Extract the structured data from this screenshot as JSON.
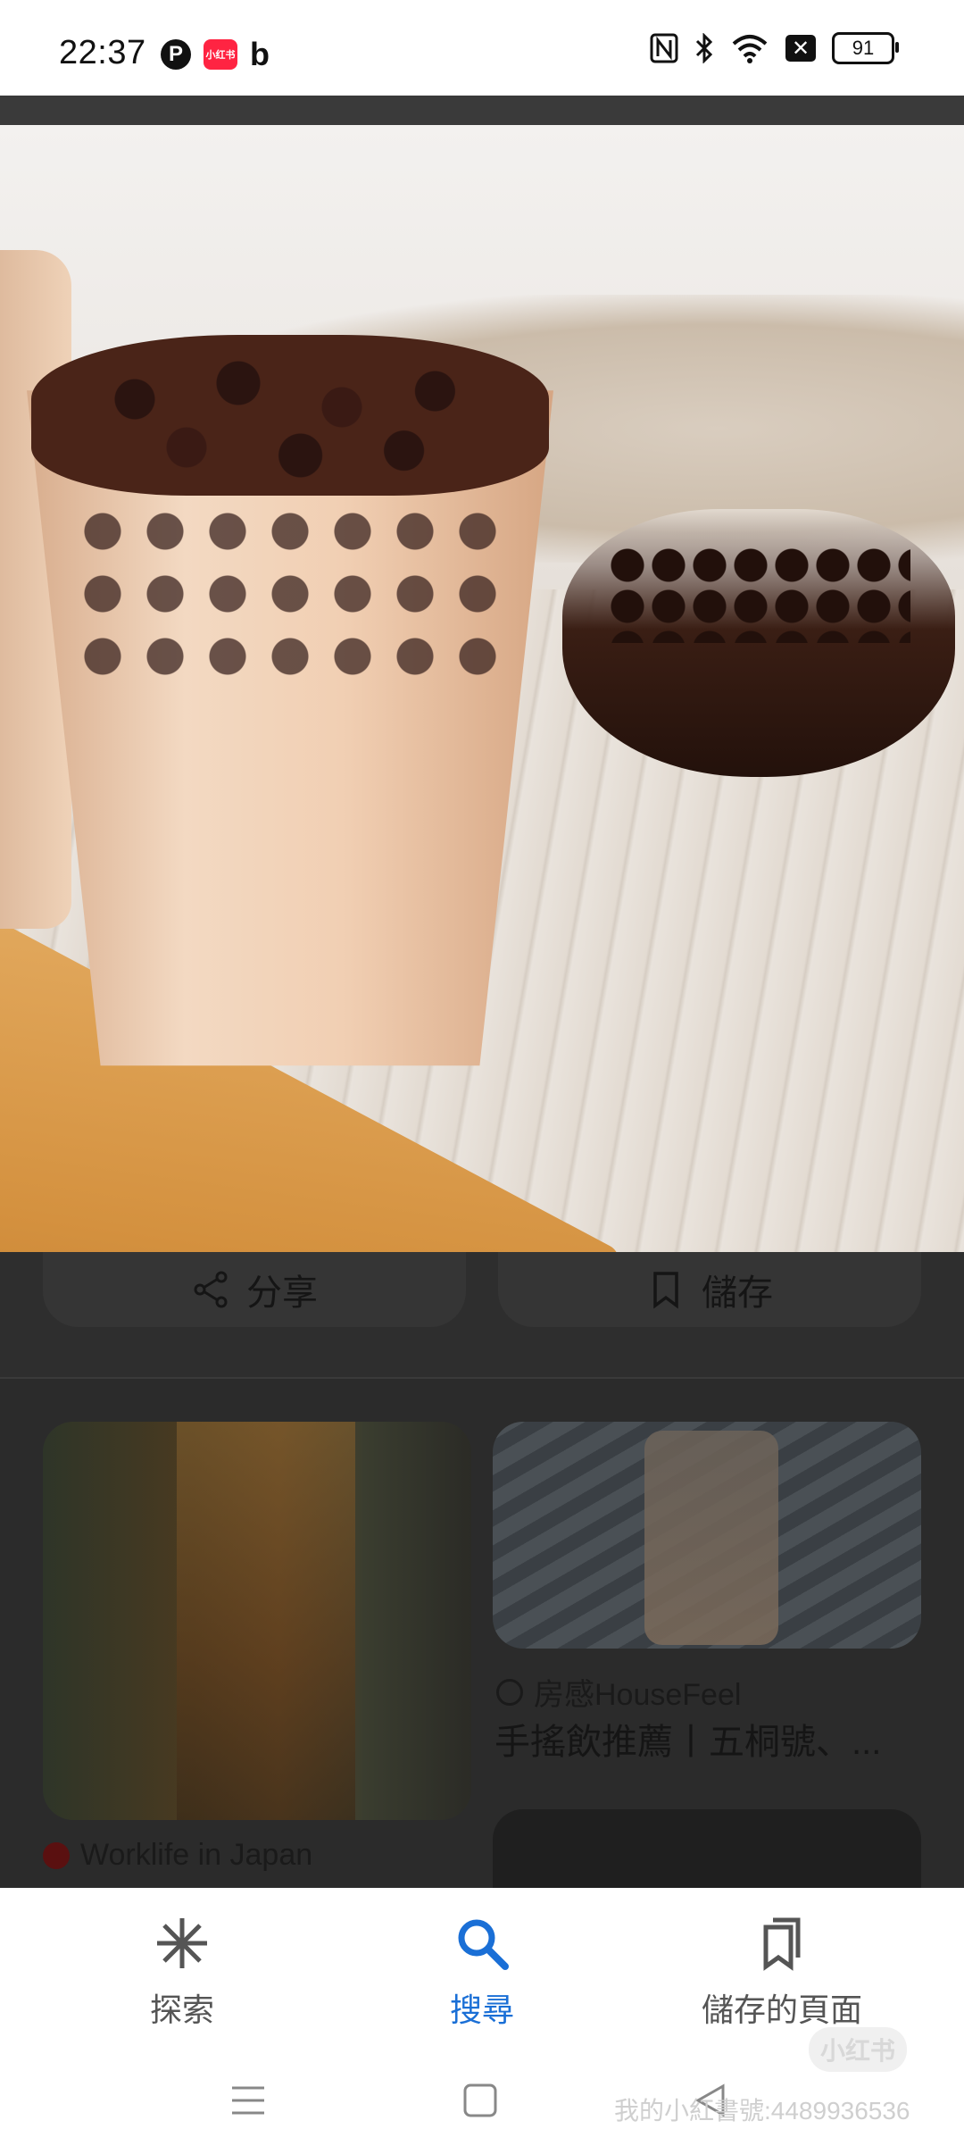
{
  "status_bar": {
    "time": "22:37",
    "battery": "91",
    "left_icons": [
      "pinterest-icon",
      "xiaohongshu-icon",
      "bing-icon"
    ],
    "right_icons": [
      "nfc-icon",
      "bluetooth-icon",
      "wifi-icon",
      "close-box-icon",
      "battery-icon"
    ],
    "xhs_badge": "小红书",
    "pin_letter": "P",
    "b_letter": "b"
  },
  "actions": {
    "share_label": "分享",
    "save_label": "儲存"
  },
  "results": [
    {
      "source": "Worklife in Japan",
      "title": ""
    },
    {
      "source": "房感HouseFeel",
      "title": "手搖飲推薦丨五桐號、..."
    }
  ],
  "bottom_nav": {
    "explore": "探索",
    "search": "搜尋",
    "saved": "儲存的頁面",
    "active": "search"
  },
  "watermark": {
    "text": "我的小紅書號:4489936536",
    "logo": "小红书"
  },
  "colors": {
    "accent": "#1a6fd6",
    "xhs_red": "#ff2442"
  }
}
